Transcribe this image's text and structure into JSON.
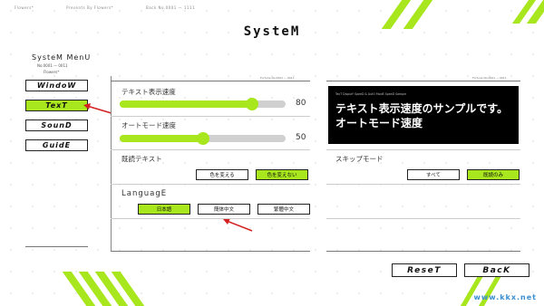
{
  "header": {
    "info": [
      "Flowers*",
      "Presents By Flowers*",
      "Back No.0001 — 1111"
    ],
    "title": "SysteM"
  },
  "menu": {
    "title": "SysteM MenU",
    "sub": "No.0001 — 0011",
    "sub2": "Flowers*",
    "items": [
      {
        "label": "WindoW",
        "active": false
      },
      {
        "label": "TexT",
        "active": true
      },
      {
        "label": "SounD",
        "active": false
      },
      {
        "label": "GuidE",
        "active": false
      }
    ]
  },
  "text_settings": {
    "panel_note": "Fortune No.0001 — 0011",
    "text_speed": {
      "label": "テキスト表示速度",
      "value": 80
    },
    "auto_speed": {
      "label": "オートモード速度",
      "value": 50
    },
    "read_text": {
      "label": "既読テキスト",
      "options": [
        "色を変える",
        "色を変えない"
      ],
      "selected": 1
    },
    "language": {
      "label": "LanguagE",
      "options": [
        "日本語",
        "簡体中文",
        "繁體中文"
      ],
      "selected": 0
    }
  },
  "preview": {
    "panel_note": "Fortune No.0001 — 0011",
    "sample_note": "TexT DisplaY SpeeD & AutO ModE SpeeD Sample",
    "sample_line1": "テキスト表示速度のサンプルです。",
    "sample_line2": "オートモード速度",
    "skip_mode": {
      "label": "スキップモード",
      "options": [
        "すべて",
        "既読のみ"
      ],
      "selected": 1
    }
  },
  "footer": {
    "reset_label": "ReseT",
    "back_label": "BacK"
  },
  "watermark": "www.kkx.net",
  "colors": {
    "accent": "#a8e61d",
    "annotation_arrow": "#d32020"
  }
}
